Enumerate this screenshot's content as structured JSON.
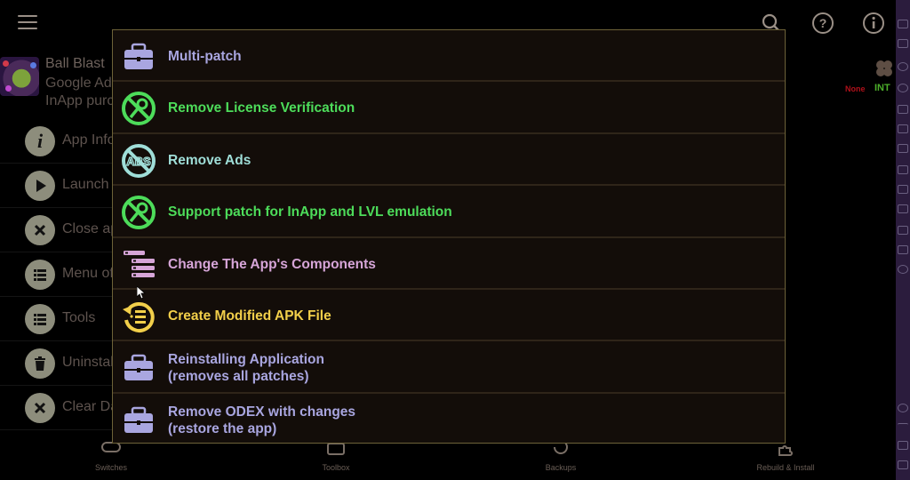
{
  "topbar": {
    "menu_icon": "hamburger-icon",
    "actions": [
      {
        "name": "search",
        "icon": "search-icon"
      },
      {
        "name": "help",
        "icon": "help-icon"
      },
      {
        "name": "info",
        "icon": "info-icon"
      }
    ]
  },
  "app": {
    "name": "Ball Blast",
    "line1": "Google Ads",
    "line2": "InApp purchases",
    "badge_none": "None",
    "badge_int": "INT"
  },
  "actions": [
    {
      "label": "App Info",
      "icon": "info-icon"
    },
    {
      "label": "Launch App",
      "icon": "play-icon"
    },
    {
      "label": "Close app",
      "icon": "close-icon"
    },
    {
      "label": "Menu of Patches",
      "icon": "list-icon"
    },
    {
      "label": "Tools",
      "icon": "list-icon"
    },
    {
      "label": "Uninstall",
      "icon": "trash-icon"
    },
    {
      "label": "Clear Data",
      "icon": "close-icon"
    }
  ],
  "dialog": {
    "items": [
      {
        "line1": "Multi-patch",
        "line2": "",
        "color": "#a9a6e0",
        "icon": "toolbox-icon"
      },
      {
        "line1": "Remove License Verification",
        "line2": "",
        "color": "#4ddc5a",
        "icon": "no-license-icon"
      },
      {
        "line1": "Remove Ads",
        "line2": "",
        "color": "#9fded8",
        "icon": "no-ads-icon"
      },
      {
        "line1": "Support patch for InApp and LVL emulation",
        "line2": "",
        "color": "#4ddc5a",
        "icon": "no-license-icon"
      },
      {
        "line1": "Change The App's Components",
        "line2": "",
        "color": "#d6a5d8",
        "icon": "components-icon"
      },
      {
        "line1": "Create Modified APK File",
        "line2": "",
        "color": "#f2cf4a",
        "icon": "rebuild-apk-icon"
      },
      {
        "line1": "Reinstalling Application",
        "line2": "(removes all patches)",
        "color": "#a9a6e0",
        "icon": "toolbox-icon"
      },
      {
        "line1": "Remove ODEX with changes",
        "line2": "(restore the app)",
        "color": "#a9a6e0",
        "icon": "toolbox-icon"
      }
    ]
  },
  "bottom_nav": [
    {
      "label": "Switches",
      "icon": "switches-icon"
    },
    {
      "label": "Toolbox",
      "icon": "toolbox-icon"
    },
    {
      "label": "Backups",
      "icon": "backups-icon"
    },
    {
      "label": "Rebuild & Install",
      "icon": "puzzle-icon"
    }
  ],
  "colors": {
    "dialog_bg": "#130d09",
    "dialog_border": "#6d6238",
    "purple": "#a9a6e0",
    "green": "#4ddc5a",
    "teal": "#9fded8",
    "pink": "#d6a5d8",
    "yellow": "#f2cf4a"
  }
}
